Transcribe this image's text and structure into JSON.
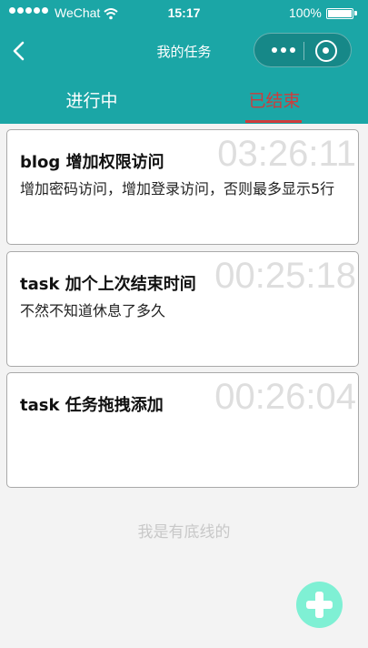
{
  "status_bar": {
    "carrier": "WeChat",
    "time": "15:17",
    "battery_percent": "100%"
  },
  "nav": {
    "title": "我的任务"
  },
  "tabs": [
    {
      "label": "进行中",
      "active": false
    },
    {
      "label": "已结束",
      "active": true
    }
  ],
  "tasks": [
    {
      "title": "blog 增加权限访问",
      "timer": "03:26:11",
      "description": "增加密码访问，增加登录访问，否则最多显示5行"
    },
    {
      "title": "task 加个上次结束时间",
      "timer": "00:25:18",
      "description": "不然不知道休息了多久"
    },
    {
      "title": "task 任务拖拽添加",
      "timer": "00:26:04",
      "description": ""
    }
  ],
  "footer": {
    "bottom_line_text": "我是有底线的"
  },
  "colors": {
    "header_bg": "#1ba6a6",
    "active_tab": "#cf3b3b",
    "add_button": "#7ff0d4"
  },
  "icons": {
    "back": "back-arrow-icon",
    "more": "more-dots-icon",
    "close": "target-circle-icon",
    "add": "plus-icon"
  }
}
